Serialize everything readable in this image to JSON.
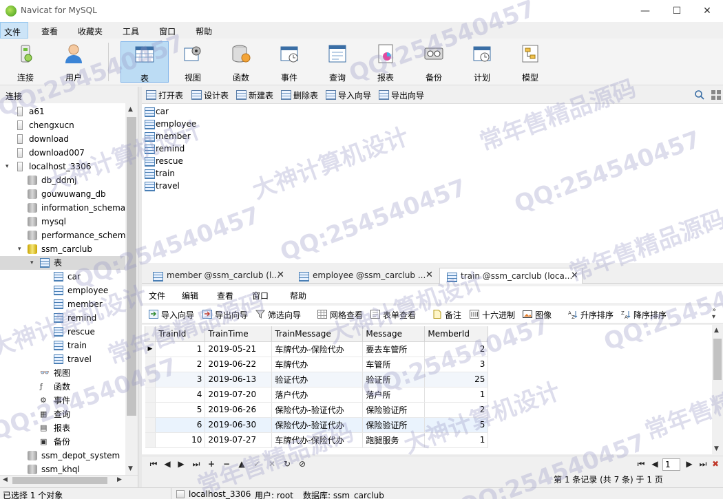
{
  "window": {
    "title": "Navicat for MySQL",
    "controls": {
      "minimize": "—",
      "maximize": "☐",
      "close": "✕"
    }
  },
  "menubar": [
    "文件",
    "查看",
    "收藏夹",
    "工具",
    "窗口",
    "帮助"
  ],
  "toolbar": [
    {
      "label": "连接",
      "icon": "connection-icon"
    },
    {
      "label": "用户",
      "icon": "user-icon"
    },
    {
      "label": "表",
      "icon": "table-icon",
      "active": true
    },
    {
      "label": "视图",
      "icon": "view-icon"
    },
    {
      "label": "函数",
      "icon": "function-icon"
    },
    {
      "label": "事件",
      "icon": "event-icon"
    },
    {
      "label": "查询",
      "icon": "query-icon"
    },
    {
      "label": "报表",
      "icon": "report-icon"
    },
    {
      "label": "备份",
      "icon": "backup-icon"
    },
    {
      "label": "计划",
      "icon": "schedule-icon"
    },
    {
      "label": "模型",
      "icon": "model-icon"
    }
  ],
  "left_panel": {
    "header": "连接",
    "tree": [
      {
        "label": "a61",
        "level": 1,
        "type": "conn"
      },
      {
        "label": "chengxucn",
        "level": 1,
        "type": "conn"
      },
      {
        "label": "download",
        "level": 1,
        "type": "conn"
      },
      {
        "label": "download007",
        "level": 1,
        "type": "conn"
      },
      {
        "label": "localhost_3306",
        "level": 1,
        "type": "conn-open",
        "arrow": "▾"
      },
      {
        "label": "db_ddmj",
        "level": 2,
        "type": "db"
      },
      {
        "label": "gouwuwang_db",
        "level": 2,
        "type": "db"
      },
      {
        "label": "information_schema",
        "level": 2,
        "type": "db"
      },
      {
        "label": "mysql",
        "level": 2,
        "type": "db"
      },
      {
        "label": "performance_schem",
        "level": 2,
        "type": "db"
      },
      {
        "label": "ssm_carclub",
        "level": 2,
        "type": "db-open",
        "arrow": "▾"
      },
      {
        "label": "表",
        "level": 3,
        "type": "table-folder",
        "arrow": "▾",
        "selected": true
      },
      {
        "label": "car",
        "level": 4,
        "type": "table"
      },
      {
        "label": "employee",
        "level": 4,
        "type": "table"
      },
      {
        "label": "member",
        "level": 4,
        "type": "table"
      },
      {
        "label": "remind",
        "level": 4,
        "type": "table"
      },
      {
        "label": "rescue",
        "level": 4,
        "type": "table"
      },
      {
        "label": "train",
        "level": 4,
        "type": "table"
      },
      {
        "label": "travel",
        "level": 4,
        "type": "table"
      },
      {
        "label": "视图",
        "level": 3,
        "type": "view"
      },
      {
        "label": "函数",
        "level": 3,
        "type": "func"
      },
      {
        "label": "事件",
        "level": 3,
        "type": "event"
      },
      {
        "label": "查询",
        "level": 3,
        "type": "query"
      },
      {
        "label": "报表",
        "level": 3,
        "type": "report"
      },
      {
        "label": "备份",
        "level": 3,
        "type": "backup"
      },
      {
        "label": "ssm_depot_system",
        "level": 2,
        "type": "db"
      },
      {
        "label": "ssm_khql",
        "level": 2,
        "type": "db"
      }
    ]
  },
  "object_toolbar": [
    "打开表",
    "设计表",
    "新建表",
    "删除表",
    "导入向导",
    "导出向导"
  ],
  "object_list": [
    "car",
    "employee",
    "member",
    "remind",
    "rescue",
    "train",
    "travel"
  ],
  "tabs": [
    {
      "label": "member @ssm_carclub (l...",
      "active": false
    },
    {
      "label": "employee @ssm_carclub ...",
      "active": false
    },
    {
      "label": "train @ssm_carclub (loca...",
      "active": true
    }
  ],
  "inner_menu": [
    "文件",
    "编辑",
    "查看",
    "窗口",
    "帮助"
  ],
  "inner_toolbar": [
    "导入向导",
    "导出向导",
    "筛选向导",
    "网格查看",
    "表单查看",
    "备注",
    "十六进制",
    "图像",
    "升序排序",
    "降序排序"
  ],
  "grid": {
    "columns": [
      "TrainId",
      "TrainTime",
      "TrainMessage",
      "Message",
      "MemberId"
    ],
    "rows": [
      [
        "1",
        "2019-05-21",
        "车牌代办-保险代办",
        "要去车管所",
        "2"
      ],
      [
        "2",
        "2019-06-22",
        "车牌代办",
        "车管所",
        "3"
      ],
      [
        "3",
        "2019-06-13",
        "验证代办",
        "验证所",
        "25"
      ],
      [
        "4",
        "2019-07-20",
        "落户代办",
        "落户所",
        "1"
      ],
      [
        "5",
        "2019-06-26",
        "保险代办-验证代办",
        "保险验证所",
        "2"
      ],
      [
        "6",
        "2019-06-30",
        "保险代办-验证代办",
        "保险验证所",
        "5"
      ],
      [
        "10",
        "2019-07-27",
        "车牌代办-保险代办",
        "跑腿服务",
        "1"
      ]
    ]
  },
  "navbar": {
    "page": "1",
    "record_info": "第 1 条记录 (共 7 条) 于 1 页"
  },
  "statusbar": {
    "selection": "已选择 1 个对象",
    "connection": "localhost_3306",
    "user": "用户: root",
    "database": "数据库: ssm_carclub"
  },
  "watermarks": [
    "QQ:254540457",
    "大神计算机设计",
    "常年售精品源码"
  ]
}
